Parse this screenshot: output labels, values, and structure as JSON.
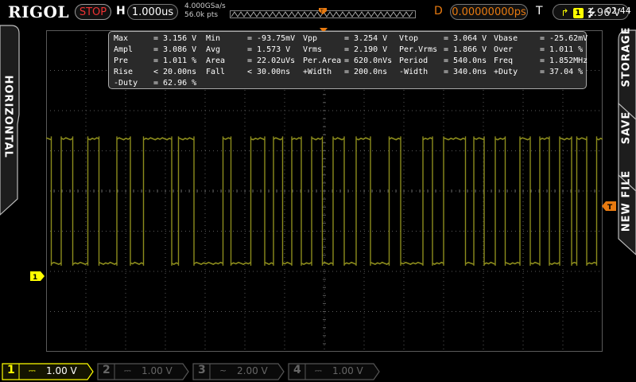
{
  "brand": "RIGOL",
  "top": {
    "run_state": "STOP",
    "horizontal_label": "H",
    "timebase": "1.000us",
    "sample_rate": "4.000GSa/s",
    "mem_depth": "56.0k pts",
    "delay_label": "D",
    "delay": "0.00000000ps",
    "trigger_label": "T",
    "trigger_channel": "1",
    "trigger_level": "1.96 V"
  },
  "side": {
    "left_tab": "HORIZONTAL",
    "right_tabs": [
      "STORAGE",
      "SAVE",
      "NEW FILE"
    ]
  },
  "markers": {
    "ch1_ground": "1",
    "trigger_level": "T"
  },
  "measurements": [
    [
      {
        "name": "Max",
        "value": "= 3.156 V"
      },
      {
        "name": "Min",
        "value": "= -93.75mV"
      },
      {
        "name": "Vpp",
        "value": "= 3.254 V"
      },
      {
        "name": "Vtop",
        "value": "= 3.064 V"
      },
      {
        "name": "Vbase",
        "value": "= -25.62mV"
      }
    ],
    [
      {
        "name": "Ampl",
        "value": "= 3.086 V"
      },
      {
        "name": "Avg",
        "value": "= 1.573 V"
      },
      {
        "name": "Vrms",
        "value": "= 2.190 V"
      },
      {
        "name": "Per.Vrms",
        "value": "= 1.866 V"
      },
      {
        "name": "Over",
        "value": "= 1.011 %"
      }
    ],
    [
      {
        "name": "Pre",
        "value": "= 1.011 %"
      },
      {
        "name": "Area",
        "value": "= 22.02uVs"
      },
      {
        "name": "Per.Area",
        "value": "= 620.0nVs"
      },
      {
        "name": "Period",
        "value": "= 540.0ns"
      },
      {
        "name": "Freq",
        "value": "= 1.852MHz"
      }
    ],
    [
      {
        "name": "Rise",
        "value": "< 20.00ns"
      },
      {
        "name": "Fall",
        "value": "< 30.00ns"
      },
      {
        "name": "+Width",
        "value": "= 200.0ns"
      },
      {
        "name": "-Width",
        "value": "= 340.0ns"
      },
      {
        "name": "+Duty",
        "value": "= 37.04 %"
      }
    ],
    [
      {
        "name": "-Duty",
        "value": "= 62.96 %"
      }
    ]
  ],
  "channels": [
    {
      "num": "1",
      "coupling": "⎓",
      "scale": "1.00 V",
      "active": true
    },
    {
      "num": "2",
      "coupling": "⎓",
      "scale": "1.00 V",
      "active": false
    },
    {
      "num": "3",
      "coupling": "~",
      "scale": "2.00 V",
      "active": false
    },
    {
      "num": "4",
      "coupling": "⎓",
      "scale": "1.00 V",
      "active": false
    }
  ],
  "status": {
    "usb_icon": "⭍",
    "time": "02:44"
  },
  "colors": {
    "ch1": "#8c8c1c",
    "ch1_label": "#ffff00",
    "stop": "#ee3333",
    "delay": "#e87a10",
    "grid": "#5a5a5a"
  },
  "chart_data": {
    "type": "line",
    "series": [
      {
        "x_divisions": [
          0,
          0.13,
          0.38,
          0.67,
          1.05,
          1.33,
          1.78,
          2.12,
          2.45,
          3.16,
          3.33,
          3.72,
          4.45,
          4.65,
          5.15,
          5.5,
          5.72,
          5.95,
          6.18,
          6.42,
          6.68,
          6.95,
          7.22,
          7.5,
          7.8,
          8.16,
          8.63,
          8.92,
          9.48,
          9.72,
          10.0,
          10.55,
          10.76,
          11.02,
          11.3,
          11.55,
          11.92,
          12.18,
          12.42,
          12.66,
          12.92,
          13.22,
          13.35,
          13.6,
          13.85,
          14.0
        ],
        "levels": [
          1,
          0,
          1,
          0,
          1,
          0,
          1,
          0,
          1,
          0,
          1,
          0,
          1,
          0,
          1,
          0,
          1,
          0,
          1,
          0,
          1,
          0,
          1,
          0,
          1,
          0,
          1,
          0,
          1,
          0,
          1,
          0,
          1,
          0,
          1,
          0,
          1,
          0,
          1,
          0,
          1,
          0,
          1,
          0,
          1
        ]
      }
    ],
    "xlim": [
      0,
      14
    ],
    "ylim": [
      -4,
      4
    ],
    "high_level_div": 1.3,
    "low_level_div": -1.8,
    "grid": true
  }
}
